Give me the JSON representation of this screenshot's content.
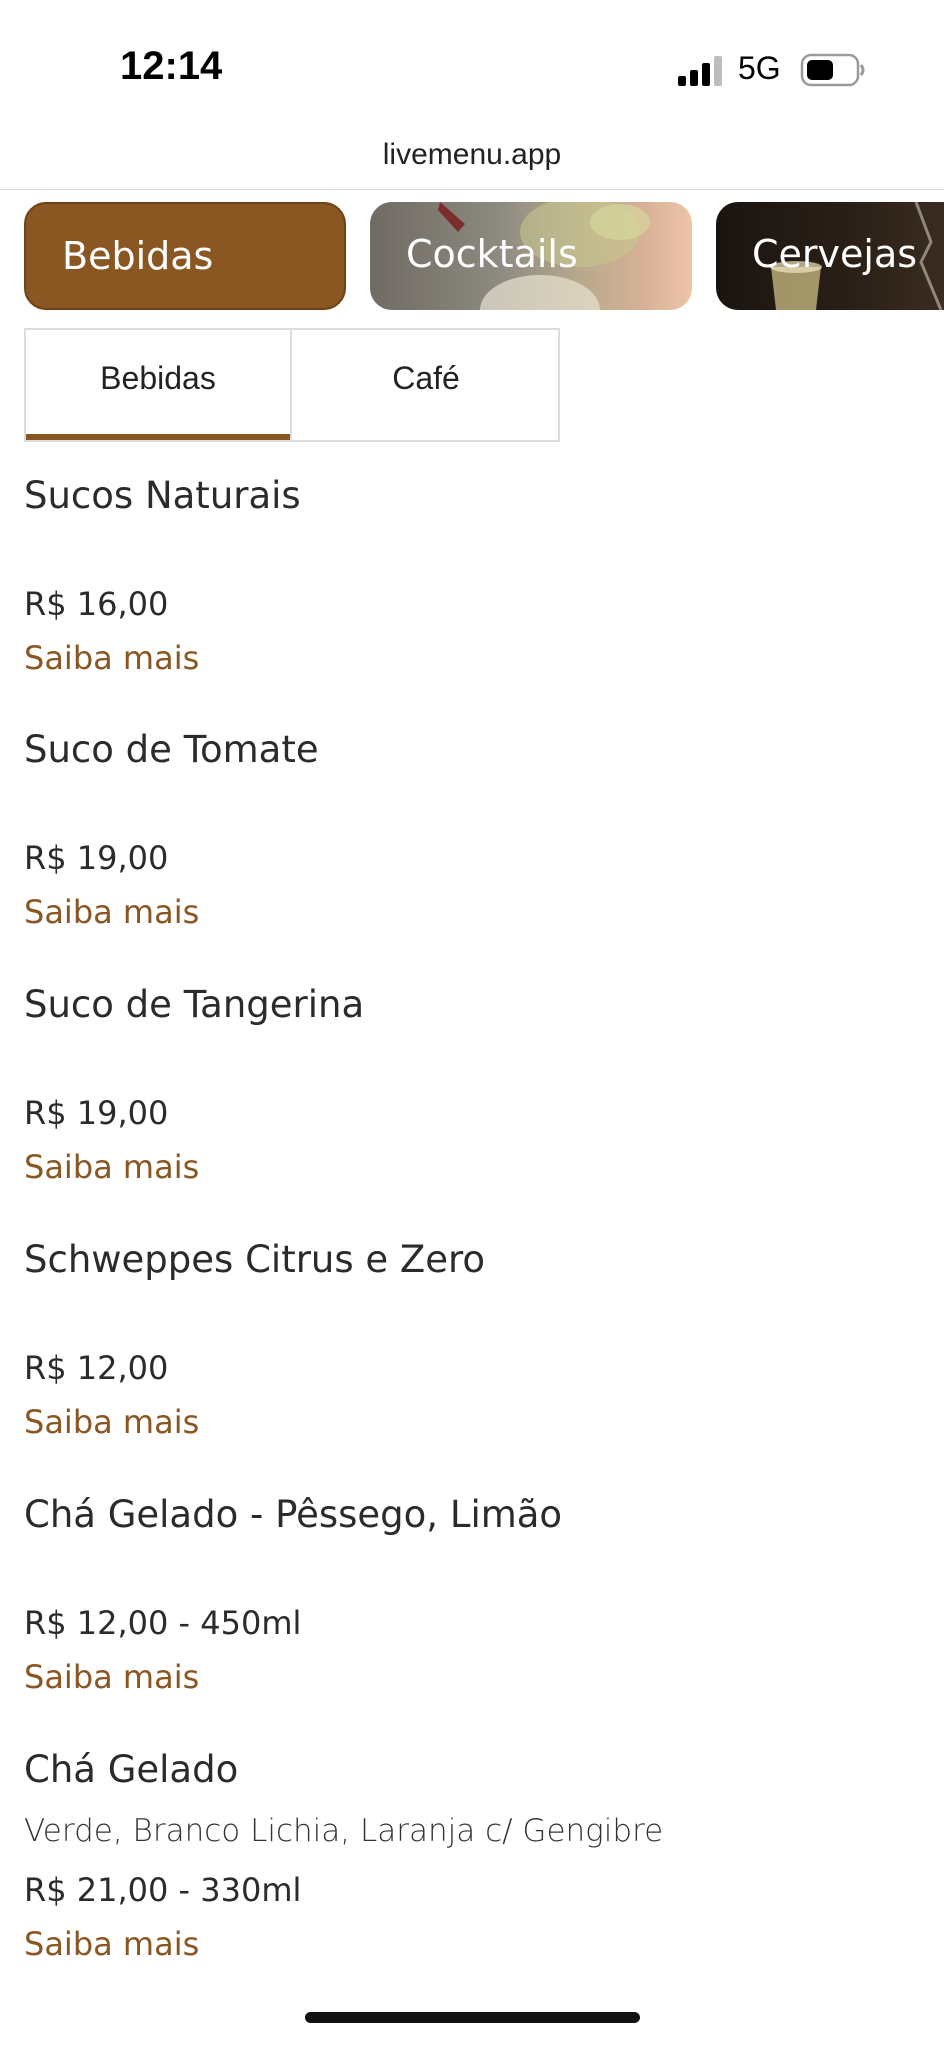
{
  "status": {
    "time": "12:14",
    "network": "5G",
    "icons": [
      "signal-icon",
      "battery-icon"
    ]
  },
  "browser": {
    "url": "livemenu.app"
  },
  "categories": [
    {
      "label": "Bebidas",
      "active": true
    },
    {
      "label": "Cocktails",
      "active": false
    },
    {
      "label": "Cervejas",
      "active": false
    }
  ],
  "subtabs": [
    {
      "label": "Bebidas",
      "active": true
    },
    {
      "label": "Café",
      "active": false
    }
  ],
  "menu": [
    {
      "name": "Sucos Naturais",
      "description": "",
      "price": "R$ 16,00",
      "more": "Saiba mais"
    },
    {
      "name": "Suco de Tomate",
      "description": "",
      "price": "R$ 19,00",
      "more": "Saiba mais"
    },
    {
      "name": "Suco de Tangerina",
      "description": "",
      "price": "R$ 19,00",
      "more": "Saiba mais"
    },
    {
      "name": "Schweppes Citrus e Zero",
      "description": "",
      "price": "R$ 12,00",
      "more": "Saiba mais"
    },
    {
      "name": "Chá Gelado - Pêssego, Limão",
      "description": "",
      "price": "R$ 12,00 - 450ml",
      "more": "Saiba mais"
    },
    {
      "name": "Chá Gelado",
      "description": "Verde, Branco Lichia, Laranja c/ Gengibre",
      "price": "R$ 21,00 - 330ml",
      "more": "Saiba mais"
    }
  ],
  "colors": {
    "accent": "#8a5622",
    "text": "#2b2b2b"
  }
}
